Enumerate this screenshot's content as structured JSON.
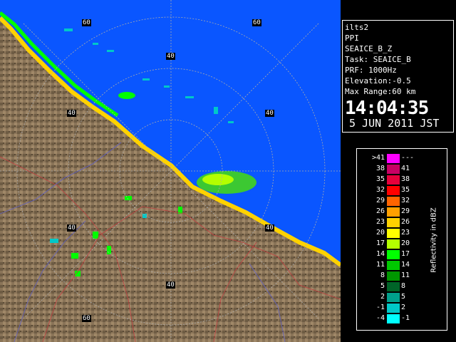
{
  "range_labels": [
    "60",
    "60",
    "40",
    "40",
    "40",
    "40",
    "40",
    "40",
    "60"
  ],
  "info": {
    "site": "ilts2",
    "product": "PPI",
    "product_name": "SEAICE_B_Z",
    "task": "Task: SEAICE_B",
    "prf": "PRF: 1000Hz",
    "elevation": "Elevation:-0.5",
    "max_range": "Max Range:60 km",
    "time": "14:04:35",
    "date": "5 JUN 2011 JST"
  },
  "legend": {
    "title": "Reflectivity in dBZ",
    "rows": [
      {
        "left": ">41",
        "right": "---",
        "color": "#ff00ff"
      },
      {
        "left": "38",
        "right": "41",
        "color": "#c80064"
      },
      {
        "left": "35",
        "right": "38",
        "color": "#e6003c"
      },
      {
        "left": "32",
        "right": "35",
        "color": "#ff0000"
      },
      {
        "left": "29",
        "right": "32",
        "color": "#ff6400"
      },
      {
        "left": "26",
        "right": "29",
        "color": "#ffa000"
      },
      {
        "left": "23",
        "right": "26",
        "color": "#ffd200"
      },
      {
        "left": "20",
        "right": "23",
        "color": "#ffff00"
      },
      {
        "left": "17",
        "right": "20",
        "color": "#b4ff00"
      },
      {
        "left": "14",
        "right": "17",
        "color": "#00ff00"
      },
      {
        "left": "11",
        "right": "14",
        "color": "#00c800"
      },
      {
        "left": "8",
        "right": "11",
        "color": "#009600"
      },
      {
        "left": "5",
        "right": "8",
        "color": "#006428"
      },
      {
        "left": "2",
        "right": "5",
        "color": "#00a08c"
      },
      {
        "left": "-1",
        "right": "2",
        "color": "#00c8c8"
      },
      {
        "left": "-4",
        "right": "-1",
        "color": "#00ffff"
      }
    ]
  },
  "colors": {
    "sea": "#0a56ff",
    "land": "#8a7458",
    "background": "#000000"
  }
}
